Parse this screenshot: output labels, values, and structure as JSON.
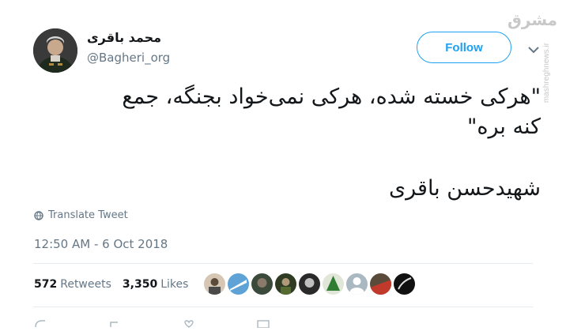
{
  "author": {
    "display_name": "محمد باقری",
    "handle": "@Bagheri_org"
  },
  "follow_label": "Follow",
  "watermark": {
    "logo": "مشرق",
    "site": "mashreghnews.ir"
  },
  "tweet": {
    "lines": [
      "\"هرکی خسته شده، هرکی نمی‌خواد بجنگه، جمع",
      "کنه بره\"",
      "شهیدحسن باقری"
    ]
  },
  "translate_label": "Translate Tweet",
  "timestamp": "12:50 AM - 6 Oct 2018",
  "stats": {
    "retweets_count": "572",
    "retweets_label": "Retweets",
    "likes_count": "3,350",
    "likes_label": "Likes"
  },
  "colors": {
    "accent": "#1da1f2",
    "muted": "#657786",
    "text": "#14171a",
    "divider": "#e6ecf0"
  },
  "icons": [
    "avatar",
    "chevron-down-icon",
    "globe-icon",
    "reply-icon",
    "retweet-icon",
    "like-icon",
    "mail-icon"
  ]
}
